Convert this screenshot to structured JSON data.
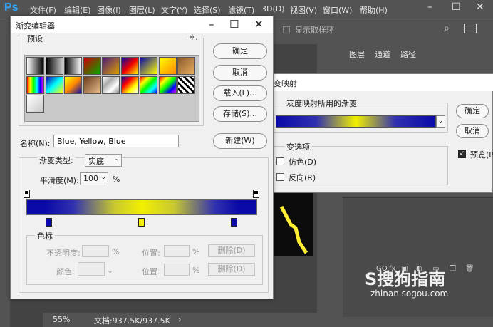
{
  "app": {
    "logo": "Ps"
  },
  "menu": [
    "文件(F)",
    "编辑(E)",
    "图像(I)",
    "图层(L)",
    "文字(Y)",
    "选择(S)",
    "滤镜(T)",
    "3D(D)",
    "视图(V)",
    "窗口(W)",
    "帮助(H)"
  ],
  "window_controls": {
    "minimize": "–",
    "maximize": "☐",
    "close": "✕"
  },
  "options_bar": {
    "show_sample_ring": "显示取样环",
    "search_icon": "⌕"
  },
  "status": {
    "zoom": "55%",
    "doc": "文档:937.5K/937.5K",
    "arrow": "›"
  },
  "panel": {
    "tabs": [
      "图层",
      "通道",
      "路径"
    ]
  },
  "layer_icons": [
    "GO",
    "fx",
    "▣",
    "◐",
    "▭",
    "❐",
    "🗑"
  ],
  "watermark": {
    "brand": "S搜狗指南",
    "url": "zhinan.sogou.com"
  },
  "gradient_editor": {
    "title": "渐变编辑器",
    "presets_label": "预设",
    "gear": "✲.",
    "buttons": {
      "ok": "确定",
      "cancel": "取消",
      "load": "载入(L)...",
      "save": "存储(S)...",
      "new": "新建(W)"
    },
    "name_label": "名称(N):",
    "name_value": "Blue, Yellow, Blue",
    "type_label": "渐变类型:",
    "type_value": "实底",
    "smooth_label": "平滑度(M):",
    "smooth_value": "100",
    "percent": "%",
    "stops": {
      "label": "色标",
      "opacity_label": "不透明度:",
      "color_label": "颜色:",
      "location_label": "位置:",
      "delete_label": "删除(D)"
    },
    "color_stops": [
      {
        "color": "#0a0aa8",
        "location": 0.1
      },
      {
        "color": "#f2f000",
        "location": 0.5
      },
      {
        "color": "#0a0aa8",
        "location": 0.9
      }
    ],
    "preset_swatches": [
      "linear-gradient(90deg,#fff,#000)",
      "linear-gradient(90deg,#000,rgba(0,0,0,0))",
      "linear-gradient(90deg,#000,#fff)",
      "linear-gradient(135deg,#c00,#0a0)",
      "linear-gradient(135deg,#4a1a7a,#e0a000)",
      "linear-gradient(135deg,#0a0aa8,#e00,#ff0)",
      "linear-gradient(135deg,#0a0aa8,#ff0)",
      "linear-gradient(135deg,#ff0,#f80)",
      "linear-gradient(135deg,#8a5a2a,#e8b060)",
      "linear-gradient(90deg,#f00,#ff0,#0f0,#0ff,#00f,#f0f)",
      "linear-gradient(135deg,#0a0aa8,#0ff,#ff0)",
      "linear-gradient(135deg,#ff0,#f80,#0a0aa8)",
      "linear-gradient(135deg,#6a3a1a,#e8c090)",
      "linear-gradient(135deg,#fff,#aaa,#fff,#888)",
      "linear-gradient(135deg,#0a0aa8,#f00,#ff0,#fff)",
      "linear-gradient(135deg,#f00,#ff0,#0f0,#0ff,#00f)",
      "linear-gradient(135deg,#f00,#ff0,#0f0,#00f,#f0f)",
      "repeating-linear-gradient(45deg,#fff 0 3px,#000 3px 6px)",
      "linear-gradient(135deg,#fff,rgba(255,255,255,0))"
    ]
  },
  "gradient_map": {
    "title": "变映射",
    "group1_label": "灰度映射所用的渐变",
    "group2_label": "变选项",
    "dither": "仿色(D)",
    "reverse": "反向(R)",
    "ok": "确定",
    "cancel": "取消",
    "preview": "预览(P",
    "preview_check": "✓",
    "dropdown_arrow": "⌄"
  }
}
